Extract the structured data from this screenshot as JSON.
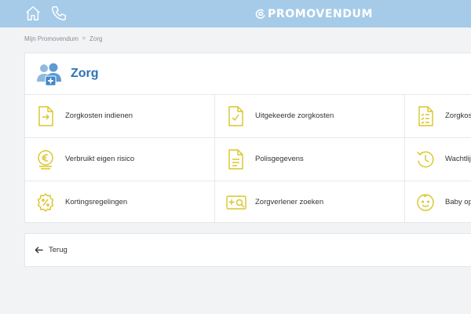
{
  "header": {
    "brand": "PROMOVENDUM"
  },
  "breadcrumb": {
    "home": "Mijn Promovendum",
    "current": "Zorg"
  },
  "section": {
    "title": "Zorg"
  },
  "tiles": [
    {
      "label": "Zorgkosten indienen",
      "icon": "document-arrow-icon"
    },
    {
      "label": "Uitgekeerde zorgkosten",
      "icon": "document-check-icon"
    },
    {
      "label": "Zorgkos",
      "icon": "document-list-icon"
    },
    {
      "label": "Verbruikt eigen risico",
      "icon": "euro-coins-icon"
    },
    {
      "label": "Polisgegevens",
      "icon": "document-lines-icon"
    },
    {
      "label": "Wachtlij",
      "icon": "clock-refresh-icon"
    },
    {
      "label": "Kortingsregelingen",
      "icon": "percent-badge-icon"
    },
    {
      "label": "Zorgverlener zoeken",
      "icon": "search-provider-icon"
    },
    {
      "label": "Baby op",
      "icon": "baby-face-icon"
    }
  ],
  "back": {
    "label": "Terug"
  },
  "colors": {
    "topbar": "#a6cbe8",
    "title": "#2a73b8",
    "icon_accent": "#d9c528"
  }
}
